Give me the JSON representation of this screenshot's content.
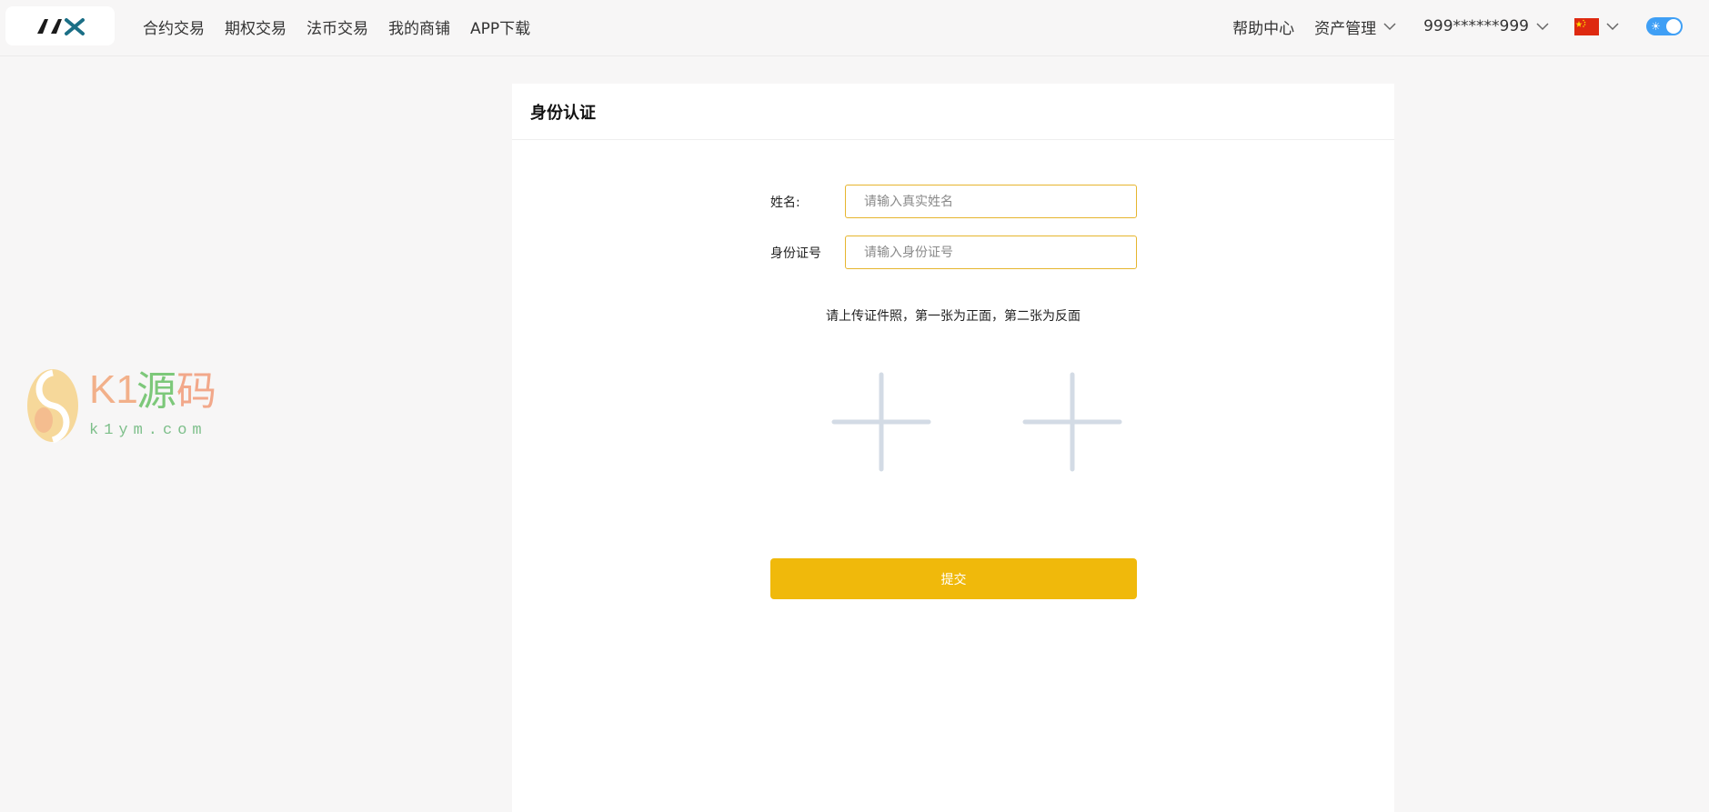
{
  "header": {
    "logo_text": "AAX",
    "nav": [
      {
        "label": "合约交易"
      },
      {
        "label": "期权交易"
      },
      {
        "label": "法币交易"
      },
      {
        "label": "我的商铺"
      },
      {
        "label": "APP下载"
      }
    ],
    "help_label": "帮助中心",
    "assets_label": "资产管理",
    "account_label": "999******999",
    "language_flag": "cn-flag-icon",
    "theme_toggle_on": true
  },
  "page": {
    "title": "身份认证",
    "form": {
      "name_label": "姓名:",
      "name_placeholder": "请输入真实姓名",
      "name_value": "",
      "id_label": "身份证号",
      "id_placeholder": "请输入身份证号",
      "id_value": ""
    },
    "upload_hint": "请上传证件照，第一张为正面，第二张为反面",
    "upload_slots": [
      "front",
      "back"
    ],
    "submit_label": "提交"
  },
  "watermark": {
    "latin": "K1",
    "cn_char_1": "源",
    "cn_char_2": "码",
    "url": "k1ym.com"
  },
  "colors": {
    "accent": "#f0b90b",
    "input_border": "#e6b52e",
    "toggle": "#3f9ff5",
    "plus_icon": "#d3dbe5",
    "background": "#f7f6f6",
    "card": "#ffffff"
  }
}
